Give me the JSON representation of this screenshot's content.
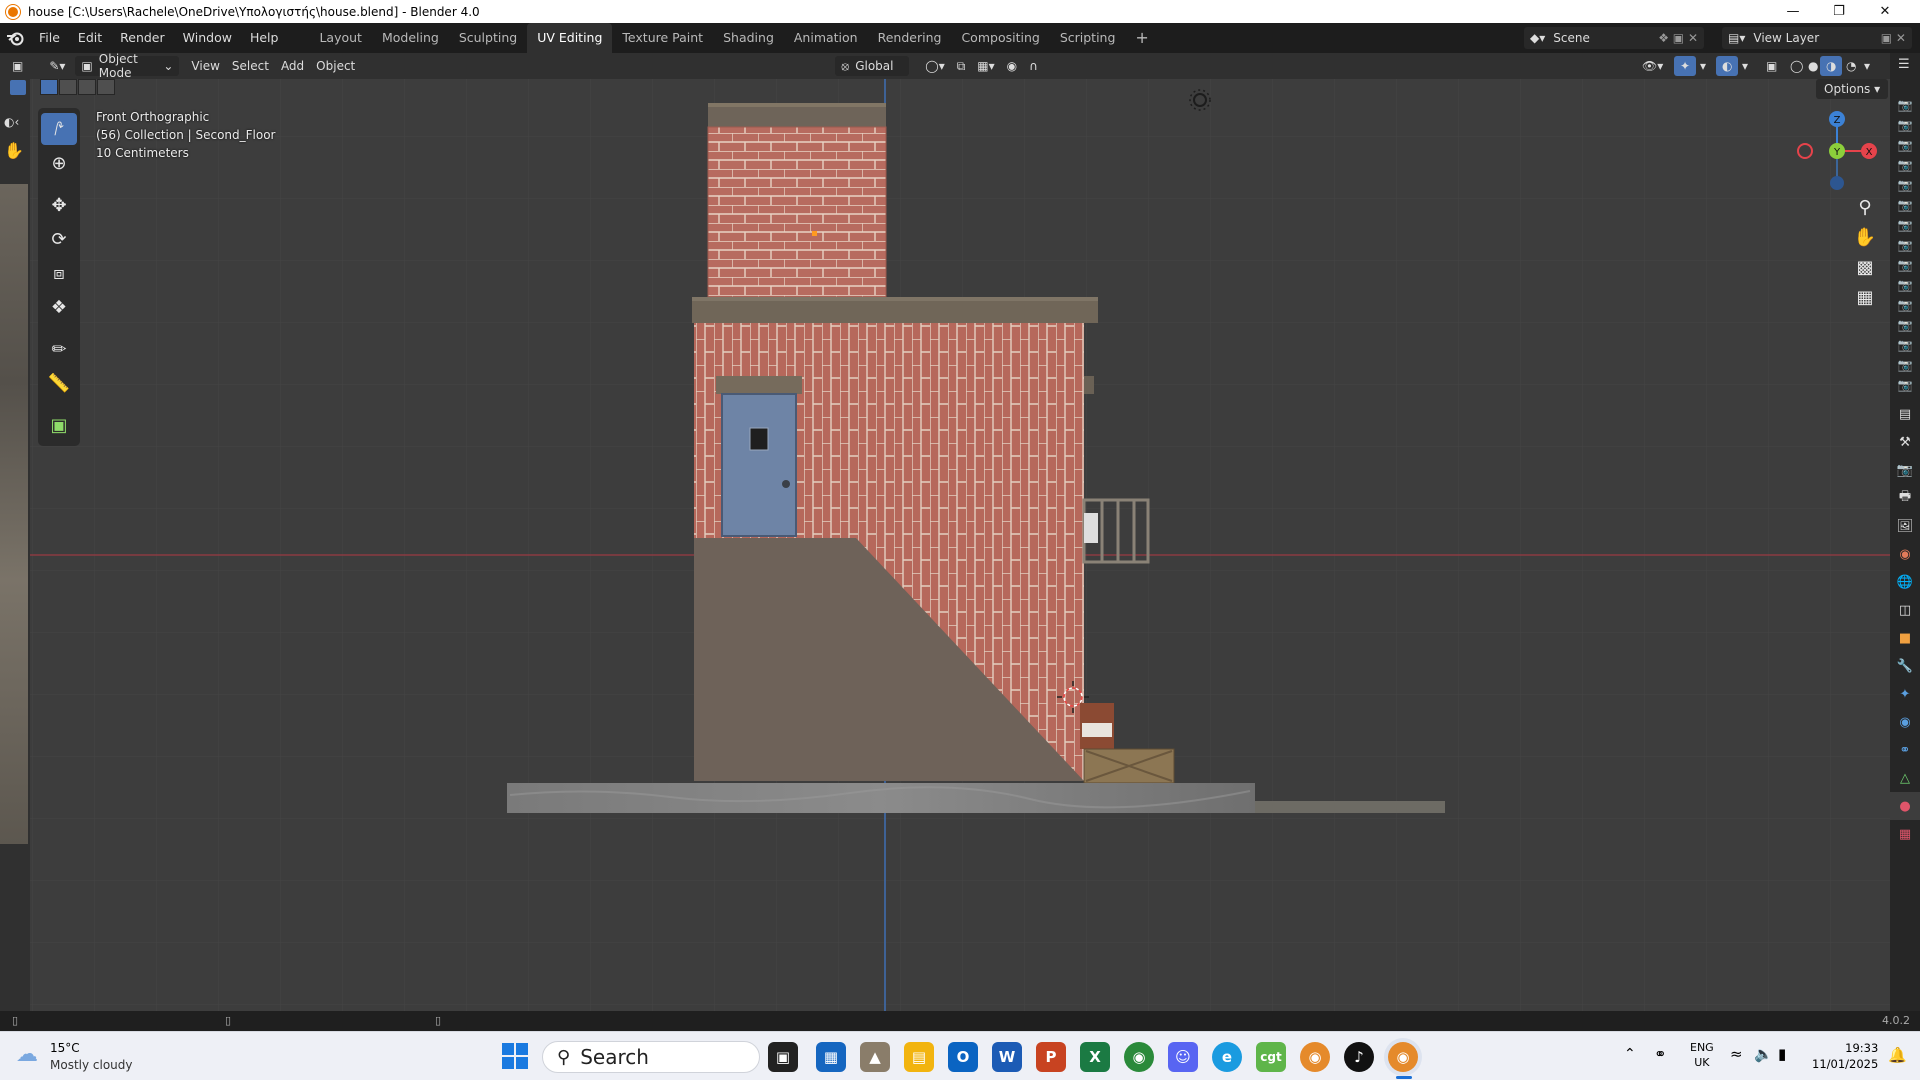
{
  "window": {
    "title": "house [C:\\Users\\Rachele\\OneDrive\\Υπολογιστής\\house.blend] - Blender 4.0"
  },
  "menu": [
    "File",
    "Edit",
    "Render",
    "Window",
    "Help"
  ],
  "workspaces": [
    "Layout",
    "Modeling",
    "Sculpting",
    "UV Editing",
    "Texture Paint",
    "Shading",
    "Animation",
    "Rendering",
    "Compositing",
    "Scripting"
  ],
  "active_workspace": "UV Editing",
  "scene": {
    "name": "Scene",
    "view_layer": "View Layer"
  },
  "header": {
    "mode": "Object Mode",
    "view": "View",
    "select": "Select",
    "add": "Add",
    "object": "Object",
    "orientation": "Global",
    "options": "Options"
  },
  "viewport_info": {
    "line1": "Front Orthographic",
    "line2": "(56) Collection | Second_Floor",
    "line3": "10 Centimeters"
  },
  "gizmo": {
    "z": "Z",
    "y": "Y",
    "x": "X"
  },
  "status": {
    "version": "4.0.2"
  },
  "taskbar": {
    "weather_temp": "15°C",
    "weather_desc": "Mostly cloudy",
    "search": "Search",
    "lang": "ENG",
    "region": "UK",
    "time": "19:33",
    "date": "11/01/2025"
  },
  "colors": {
    "accent": "#4772b3",
    "x_axis": "#e6434b",
    "y_axis": "#8ccf3b",
    "z_axis": "#3c82d6"
  }
}
